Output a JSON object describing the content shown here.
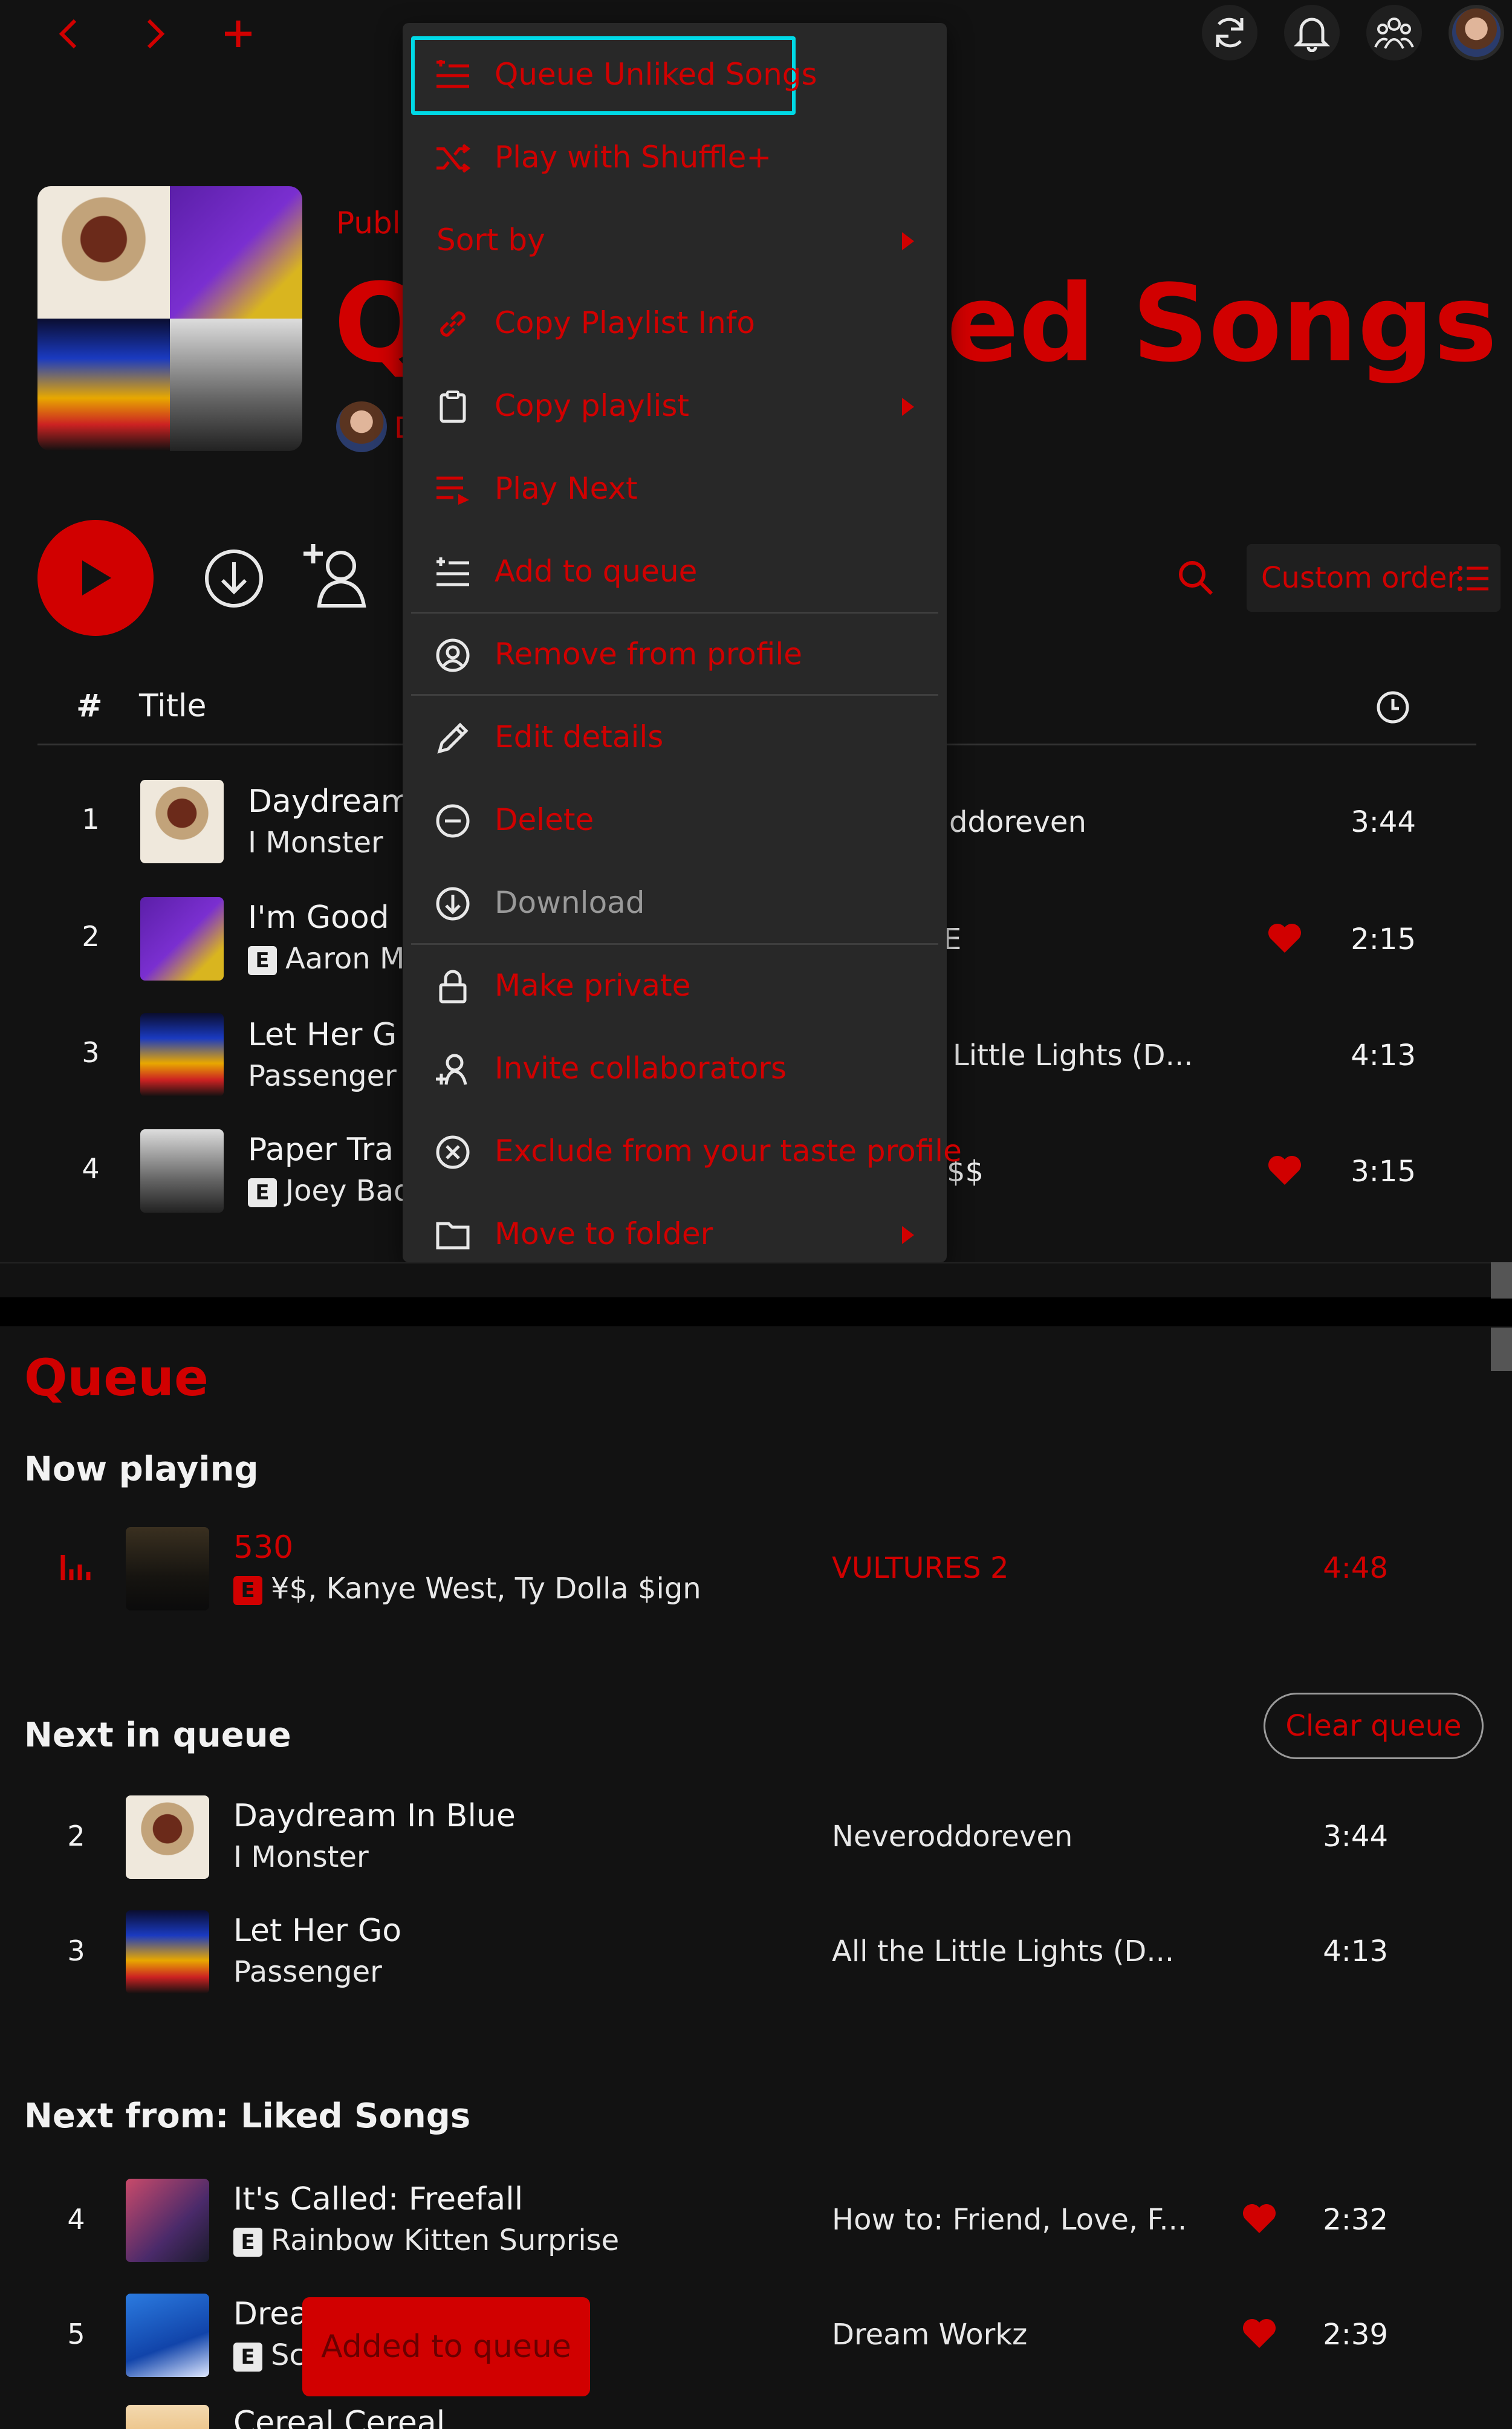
{
  "topbar": {
    "back_icon": "chevron-left-icon",
    "forward_icon": "chevron-right-icon",
    "create_icon": "plus-icon",
    "right_icons": [
      "refresh-icon",
      "bell-icon",
      "friends-icon",
      "avatar"
    ]
  },
  "playlist": {
    "type_label": "Publi",
    "title_left": "Q",
    "title_right": "ed Songs",
    "owner_initial": "D"
  },
  "actions": {
    "sort_label": "Custom order"
  },
  "tracklist": {
    "header_num": "#",
    "header_title": "Title",
    "rows": [
      {
        "num": "1",
        "title": "Daydream",
        "artist": "I Monster",
        "explicit": false,
        "album": "ddoreven",
        "liked": false,
        "duration": "3:44"
      },
      {
        "num": "2",
        "title": "I'm Good",
        "artist": "Aaron M",
        "explicit": true,
        "album": "E",
        "liked": true,
        "duration": "2:15"
      },
      {
        "num": "3",
        "title": "Let Her G",
        "artist": "Passenger",
        "explicit": false,
        "album": "Little Lights (D...",
        "liked": false,
        "duration": "4:13"
      },
      {
        "num": "4",
        "title": "Paper Tra",
        "artist": "Joey Bad",
        "explicit": true,
        "album": "$$",
        "liked": true,
        "duration": "3:15"
      }
    ]
  },
  "context_menu": {
    "items": [
      {
        "label": "Queue Unliked Songs",
        "icon": "queue-icon",
        "arrow": false,
        "highlighted": true
      },
      {
        "label": "Play with Shuffle+",
        "icon": "shuffle-icon",
        "arrow": false
      },
      {
        "label": "Sort by",
        "icon": "",
        "arrow": true
      },
      {
        "label": "Copy Playlist Info",
        "icon": "link-icon",
        "arrow": false
      },
      {
        "label": "Copy playlist",
        "icon": "clipboard-icon",
        "arrow": true
      },
      {
        "label": "Play Next",
        "icon": "play-next-icon",
        "arrow": false
      },
      {
        "label": "Add to queue",
        "icon": "add-queue-icon",
        "arrow": false
      },
      {
        "label": "Remove from profile",
        "icon": "profile-icon",
        "arrow": false
      },
      {
        "label": "Edit details",
        "icon": "pencil-icon",
        "arrow": false
      },
      {
        "label": "Delete",
        "icon": "minus-circle-icon",
        "arrow": false
      },
      {
        "label": "Download",
        "icon": "download-icon",
        "arrow": false,
        "disabled": true
      },
      {
        "label": "Make private",
        "icon": "lock-icon",
        "arrow": false
      },
      {
        "label": "Invite collaborators",
        "icon": "add-user-icon",
        "arrow": false
      },
      {
        "label": "Exclude from your taste profile",
        "icon": "x-circle-icon",
        "arrow": false
      },
      {
        "label": "Move to folder",
        "icon": "folder-icon",
        "arrow": true
      }
    ]
  },
  "queue": {
    "title": "Queue",
    "now_playing_label": "Now playing",
    "now_playing": {
      "title": "530",
      "artist": "¥$, Kanye West, Ty Dolla $ign",
      "explicit": true,
      "album": "VULTURES 2",
      "duration": "4:48"
    },
    "next_in_queue_label": "Next in queue",
    "clear_label": "Clear queue",
    "next_in_queue": [
      {
        "num": "2",
        "title": "Daydream In Blue",
        "artist": "I Monster",
        "explicit": false,
        "album": "Neveroddoreven",
        "liked": false,
        "duration": "3:44"
      },
      {
        "num": "3",
        "title": "Let Her Go",
        "artist": "Passenger",
        "explicit": false,
        "album": "All the Little Lights (D...",
        "liked": false,
        "duration": "4:13"
      }
    ],
    "next_from_label": "Next from: Liked Songs",
    "next_from": [
      {
        "num": "4",
        "title": "It's Called: Freefall",
        "artist": "Rainbow Kitten Surprise",
        "explicit": true,
        "album": "How to: Friend, Love, F...",
        "liked": true,
        "duration": "2:32"
      },
      {
        "num": "5",
        "title": "Drea",
        "artist": "Sc",
        "explicit": true,
        "album": "Dream Workz",
        "liked": true,
        "duration": "2:39"
      },
      {
        "num": "",
        "title": "Cereal Cereal",
        "artist": "",
        "explicit": false,
        "album": "",
        "liked": false,
        "duration": ""
      }
    ]
  },
  "toast": {
    "text": "Added to queue"
  },
  "colors": {
    "accent": "#d10000",
    "background": "#121212",
    "menu": "#282828",
    "highlight": "#00d9e6"
  }
}
